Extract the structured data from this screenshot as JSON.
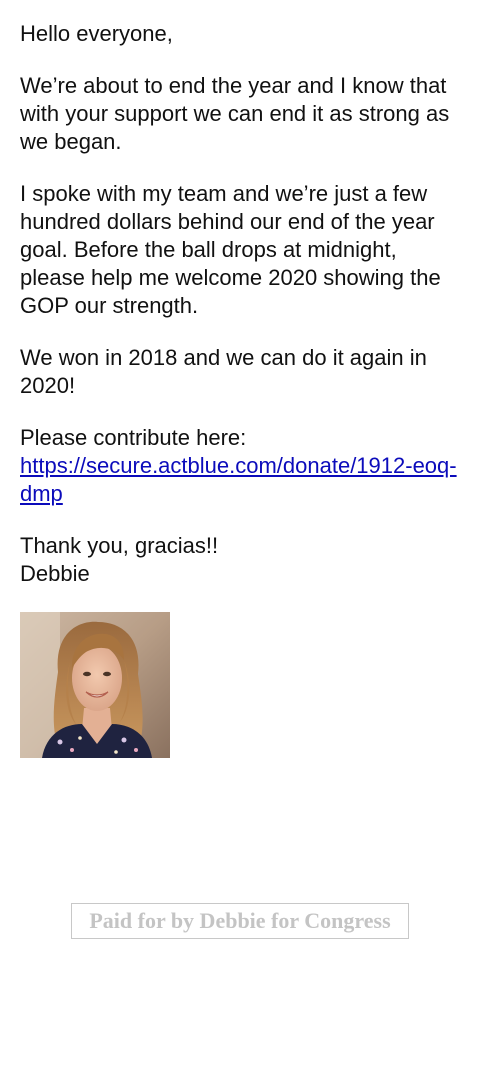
{
  "email": {
    "greeting": "Hello everyone,",
    "paragraph_1": "We’re about to end the year and I know that with your support we can end it as strong as we began.",
    "paragraph_2": "I spoke with my team and we’re just a few hundred dollars behind our end of the year goal. Before the ball drops at midnight, please help me welcome 2020 showing the GOP our strength.",
    "paragraph_3": "We won in 2018 and we can do it again in 2020!",
    "contribute_label": "Please contribute here:",
    "donate_link": "https://secure.actblue.com/donate/1912-eoq-dmp",
    "thanks": "Thank you, gracias!!",
    "signature": "Debbie"
  },
  "photo": {
    "icon": "candidate-portrait"
  },
  "footer": {
    "disclaimer": "Paid for by Debbie for Congress"
  },
  "colors": {
    "link": "#0b0bbb",
    "text": "#111111",
    "disclaimer": "#c4c4c4"
  }
}
